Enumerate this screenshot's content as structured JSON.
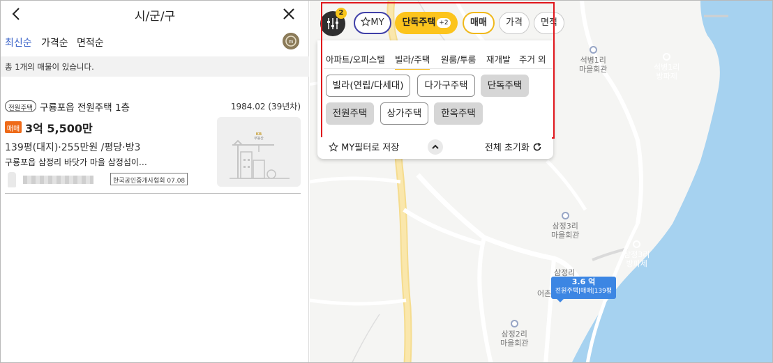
{
  "left_panel": {
    "title": "시/군/구",
    "sort_options": [
      "최신순",
      "가격순",
      "면적순"
    ],
    "count_text": "총 1개의 매물이 있습니다.",
    "listing": {
      "type_badge": "전원주택",
      "title": "구룡포읍 전원주택 1층",
      "year": "1984.02 (39년차)",
      "deal_badge": "매매",
      "price": "3억 5,500만",
      "spec": "139평(대지)·255만원 /평당·방3",
      "desc": "구룡포읍 삼정리 바닷가 마을 삼정섬이…",
      "agency": "한국공인중개사협회 07.08",
      "thumb_brand": "KB",
      "thumb_caption": "부동산"
    }
  },
  "map": {
    "filter_count": "2",
    "chips": {
      "my": "MY",
      "house": "단독주택",
      "house_plus": "+2",
      "deal": "매매",
      "price": "가격",
      "area": "면적"
    },
    "tabs": [
      "아파트/오피스텔",
      "빌라/주택",
      "원룸/투룸",
      "재개발",
      "주거 외"
    ],
    "options": [
      {
        "label": "빌라(연립/다세대)",
        "selected": false
      },
      {
        "label": "다가구주택",
        "selected": false
      },
      {
        "label": "단독주택",
        "selected": true
      },
      {
        "label": "전원주택",
        "selected": true
      },
      {
        "label": "상가주택",
        "selected": false
      },
      {
        "label": "한옥주택",
        "selected": true
      }
    ],
    "save_label": "MY필터로 저장",
    "reset_label": "전체 초기화",
    "pois": [
      {
        "name": "석병1리",
        "sub": "마을회관",
        "sea": false
      },
      {
        "name": "석병1리",
        "sub": "방파제",
        "sea": true
      },
      {
        "name": "삼정3리",
        "sub": "마을회관",
        "sea": false
      },
      {
        "name": "삼정3리",
        "sub": "방파제",
        "sea": true
      },
      {
        "name": "삼정2리",
        "sub": "마을회관",
        "sea": false
      }
    ],
    "marker": {
      "price": "3.6 억",
      "info": "전원주택|매매|139평",
      "behind_a": "삼정리",
      "behind_b": "어촌"
    }
  },
  "colors": {
    "accent_yellow": "#fcc41d",
    "active_sort": "#3a63c9",
    "deal_orange": "#ee6a18",
    "marker_blue": "#3c86e3",
    "highlight_red": "#e0161c",
    "sea": "#a6d2f0"
  }
}
